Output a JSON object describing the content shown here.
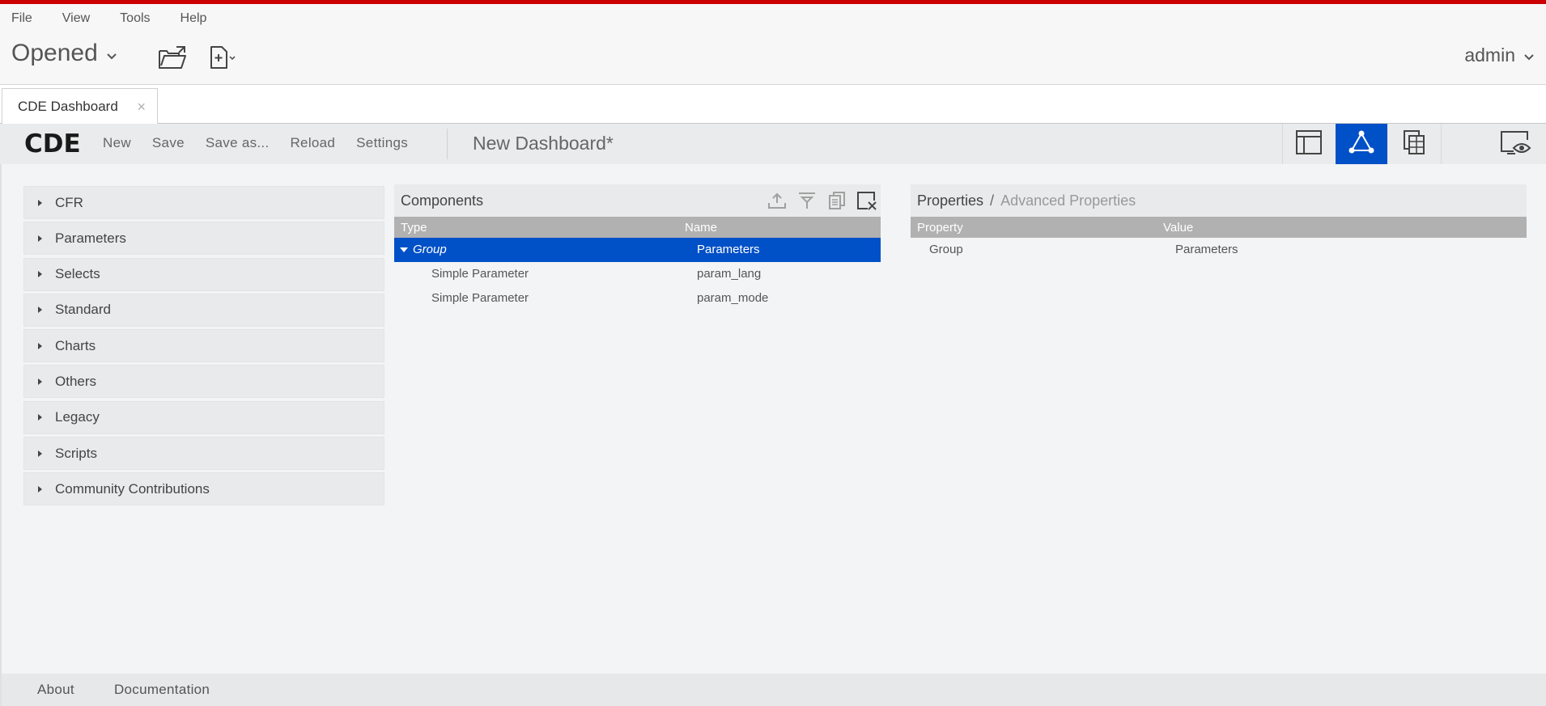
{
  "menubar": {
    "items": [
      "File",
      "View",
      "Tools",
      "Help"
    ]
  },
  "header": {
    "opened_label": "Opened",
    "user": "admin",
    "icons": [
      "open-folder-icon",
      "new-file-icon"
    ]
  },
  "tabs": [
    {
      "label": "CDE Dashboard",
      "close": "×"
    }
  ],
  "cde_toolbar": {
    "logo": "CDE",
    "menu": [
      "New",
      "Save",
      "Save as...",
      "Reload",
      "Settings"
    ],
    "dashboard_title": "New Dashboard*",
    "modes": [
      "layout-icon",
      "components-icon",
      "datasources-icon",
      "preview-icon"
    ],
    "active_mode": "components-icon"
  },
  "accordion": {
    "items": [
      "CFR",
      "Parameters",
      "Selects",
      "Standard",
      "Charts",
      "Others",
      "Legacy",
      "Scripts",
      "Community Contributions"
    ]
  },
  "components": {
    "title": "Components",
    "columns": {
      "type": "Type",
      "name": "Name"
    },
    "rows": [
      {
        "type": "Group",
        "name": "Parameters",
        "selected": true,
        "expanded": true
      },
      {
        "type": "Simple Parameter",
        "name": "param_lang"
      },
      {
        "type": "Simple Parameter",
        "name": "param_mode"
      }
    ],
    "tools": [
      "move-up-icon",
      "move-down-icon",
      "duplicate-icon",
      "delete-icon"
    ]
  },
  "properties": {
    "title": "Properties",
    "separator": "/",
    "advanced": "Advanced Properties",
    "columns": {
      "property": "Property",
      "value": "Value"
    },
    "rows": [
      {
        "property": "Group",
        "value": "Parameters"
      }
    ]
  },
  "footer": {
    "links": [
      "About",
      "Documentation"
    ]
  },
  "colors": {
    "accent": "#cc0000",
    "selection": "#0050c7",
    "column_header": "#b1b1b1"
  }
}
